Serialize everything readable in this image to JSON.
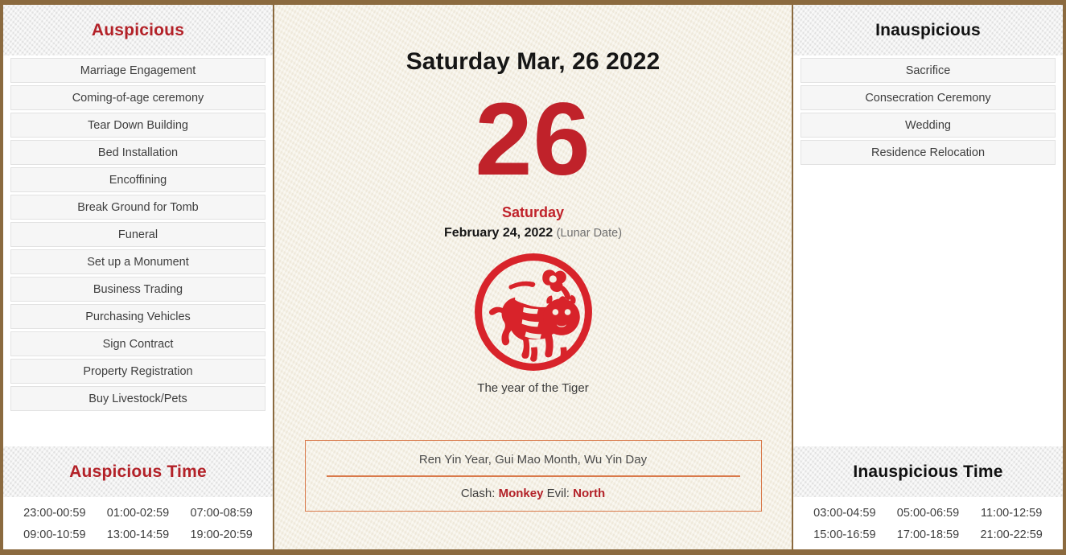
{
  "theme": {
    "frame_color": "#8B6A3F",
    "accent_red": "#B32128",
    "day_red": "#C0222A",
    "paper": "#f4efe2",
    "info_border": "#D9794A"
  },
  "left_panel": {
    "header": "Auspicious",
    "items": [
      "Marriage Engagement",
      "Coming-of-age ceremony",
      "Tear Down Building",
      "Bed Installation",
      "Encoffining",
      "Break Ground for Tomb",
      "Funeral",
      "Set up a Monument",
      "Business Trading",
      "Purchasing Vehicles",
      "Sign Contract",
      "Property Registration",
      "Buy Livestock/Pets"
    ],
    "time_header": "Auspicious Time",
    "times": [
      "23:00-00:59",
      "01:00-02:59",
      "07:00-08:59",
      "09:00-10:59",
      "13:00-14:59",
      "19:00-20:59"
    ]
  },
  "right_panel": {
    "header": "Inauspicious",
    "items": [
      "Sacrifice",
      "Consecration Ceremony",
      "Wedding",
      "Residence Relocation"
    ],
    "time_header": "Inauspicious Time",
    "times": [
      "03:00-04:59",
      "05:00-06:59",
      "11:00-12:59",
      "15:00-16:59",
      "17:00-18:59",
      "21:00-22:59"
    ]
  },
  "center": {
    "full_date": "Saturday Mar, 26 2022",
    "day_number": "26",
    "weekday": "Saturday",
    "lunar_date": "February 24, 2022",
    "lunar_label": "(Lunar Date)",
    "zodiac_icon": "tiger-papercut-icon",
    "zodiac_caption": "The year of the Tiger",
    "ganzhi": "Ren Yin Year, Gui Mao Month, Wu Yin Day",
    "clash_prefix": "Clash:",
    "clash_value": "Monkey",
    "evil_prefix": "Evil:",
    "evil_value": "North"
  }
}
